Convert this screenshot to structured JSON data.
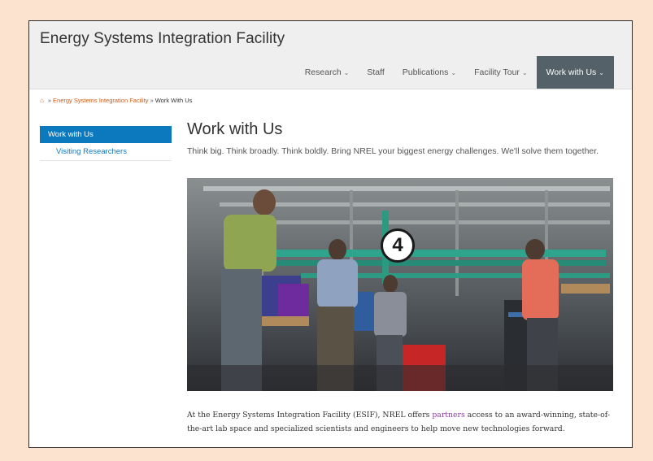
{
  "header": {
    "site_title": "Energy Systems Integration Facility",
    "nav": [
      {
        "label": "Research",
        "dropdown": true
      },
      {
        "label": "Staff",
        "dropdown": false
      },
      {
        "label": "Publications",
        "dropdown": true
      },
      {
        "label": "Facility Tour",
        "dropdown": true
      },
      {
        "label": "Work with Us",
        "dropdown": true,
        "active": true
      }
    ]
  },
  "breadcrumb": {
    "home_icon": "home-icon",
    "separator": "»",
    "link": "Energy Systems Integration Facility",
    "current": "Work With Us"
  },
  "sidenav": {
    "items": [
      {
        "label": "Work with Us",
        "active": true
      },
      {
        "label": "Visiting Researchers",
        "active": false
      }
    ]
  },
  "main": {
    "heading": "Work with Us",
    "intro": "Think big. Think broadly. Think boldly. Bring NREL your biggest energy challenges. We'll solve them together.",
    "hero_alt": "",
    "badge": "4",
    "body_before": "At the Energy Systems Integration Facility (ESIF), NREL offers ",
    "body_link": "partners",
    "body_after": " access to an award-winning, state-of-the-art lab space and specialized scientists and engineers to help move new technologies forward."
  },
  "colors": {
    "page_bg": "#fbe3d0",
    "nav_active": "#556168",
    "accent_blue": "#0c79bf",
    "breadcrumb_link": "#c85a17",
    "body_link": "#8a3fa1"
  }
}
